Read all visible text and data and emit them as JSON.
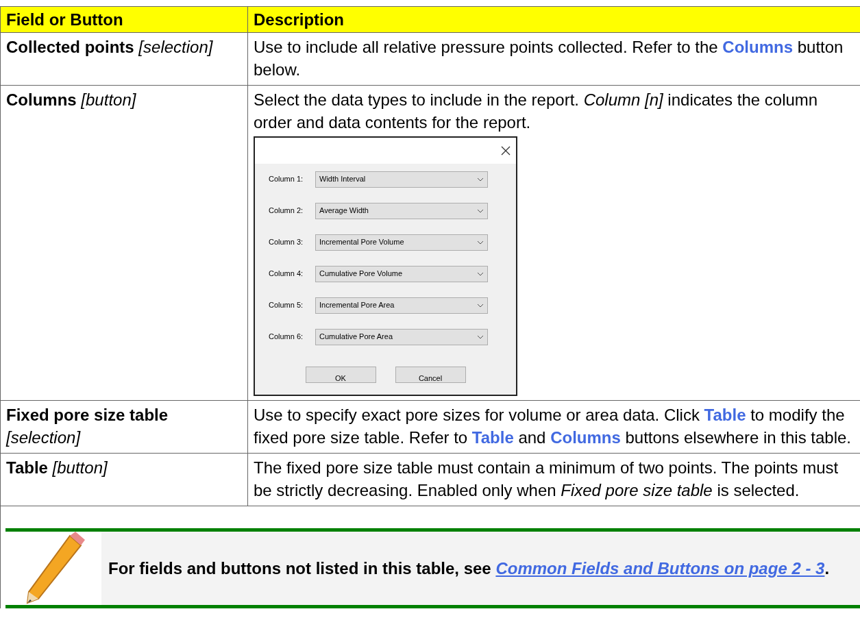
{
  "table": {
    "columns": [
      "Field or Button",
      "Description"
    ],
    "rows": [
      {
        "field": "Collected points",
        "type": "[selection]",
        "description": [
          {
            "kind": "plain",
            "text": "Use to include all relative pressure points collected. Refer to the "
          },
          {
            "kind": "link",
            "text": "Columns"
          },
          {
            "kind": "plain",
            "text": " button below."
          }
        ]
      },
      {
        "field": "Columns",
        "type": "[button]",
        "description": [
          {
            "kind": "plain",
            "text": "Select the data types to include in the report. "
          },
          {
            "kind": "italic",
            "text": "Column [n]"
          },
          {
            "kind": "plain",
            "text": " indicates the column order and data contents for the report."
          }
        ],
        "dialog": {
          "rows": [
            {
              "label": "Column 1:",
              "value": "Width Interval"
            },
            {
              "label": "Column 2:",
              "value": "Average Width"
            },
            {
              "label": "Column 3:",
              "value": "Incremental Pore Volume"
            },
            {
              "label": "Column 4:",
              "value": "Cumulative Pore Volume"
            },
            {
              "label": "Column 5:",
              "value": "Incremental Pore Area"
            },
            {
              "label": "Column 6:",
              "value": "Cumulative Pore Area"
            }
          ],
          "buttons": [
            "OK",
            "Cancel"
          ]
        }
      },
      {
        "field": "Fixed pore size table",
        "type": "[selection]",
        "description": [
          {
            "kind": "plain",
            "text": "Use to specify exact pore sizes for volume or area data. Click "
          },
          {
            "kind": "link",
            "text": "Table"
          },
          {
            "kind": "plain",
            "text": " to modify the fixed pore size table. Refer to "
          },
          {
            "kind": "link",
            "text": "Table"
          },
          {
            "kind": "plain",
            "text": " and "
          },
          {
            "kind": "link",
            "text": "Columns"
          },
          {
            "kind": "plain",
            "text": " buttons elsewhere in this table."
          }
        ]
      },
      {
        "field": "Table",
        "type": "[button]",
        "description": [
          {
            "kind": "plain",
            "text": "The fixed pore size table must contain a minimum of two points. The points must be strictly decreasing. Enabled only when "
          },
          {
            "kind": "italic",
            "text": "Fixed pore size table"
          },
          {
            "kind": "plain",
            "text": " is selected."
          }
        ]
      }
    ]
  },
  "note": {
    "text": "For fields and buttons not listed in this table, see ",
    "link": "Common Fields and Buttons on page 2 - 3",
    "end": "."
  }
}
